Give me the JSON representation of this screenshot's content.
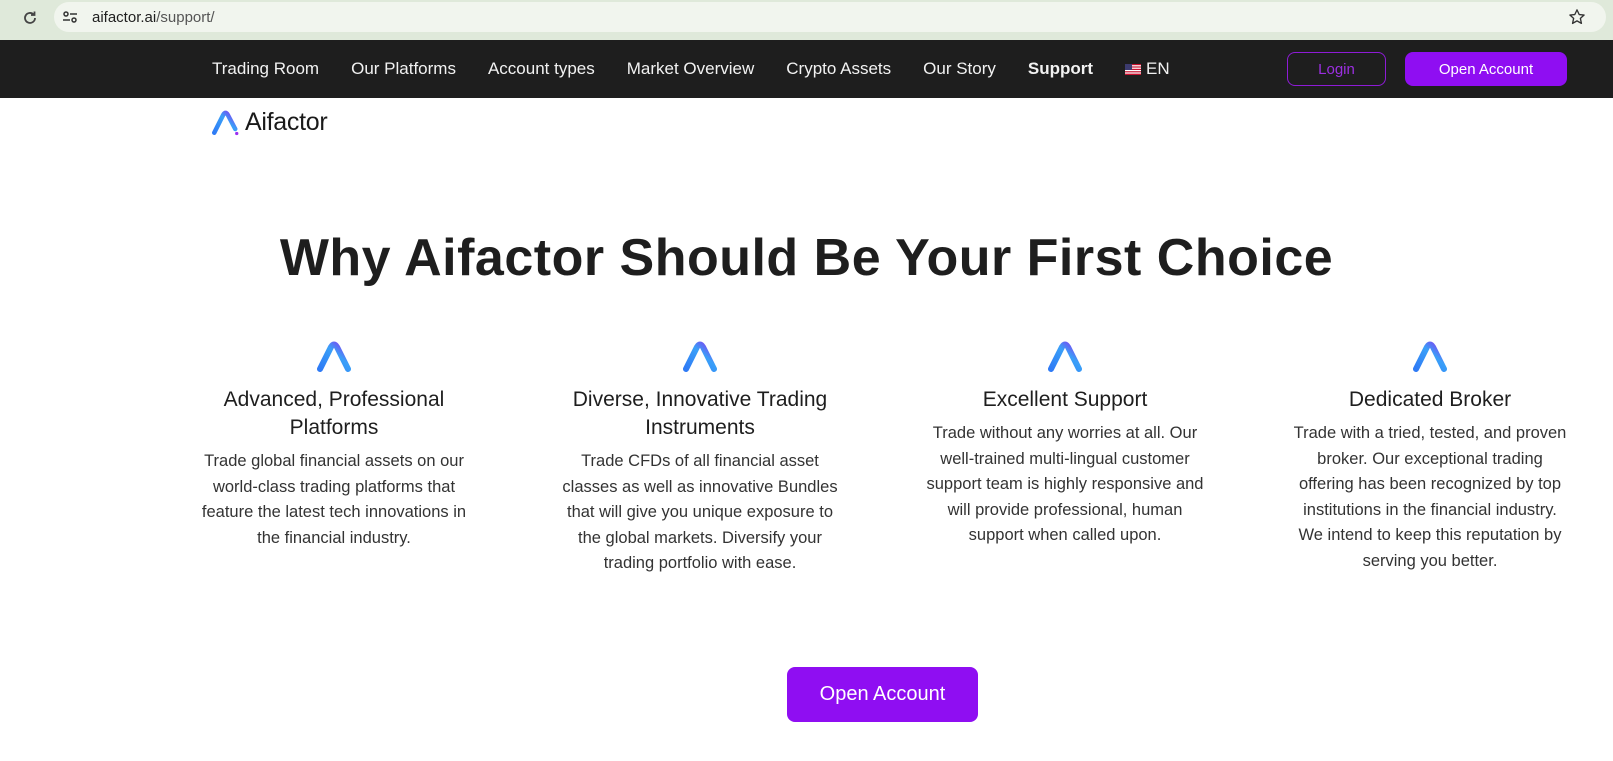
{
  "browser": {
    "url_domain": "aifactor.ai",
    "url_path": "/support/"
  },
  "nav": {
    "links": [
      {
        "label": "Trading Room"
      },
      {
        "label": "Our Platforms"
      },
      {
        "label": "Account types"
      },
      {
        "label": "Market Overview"
      },
      {
        "label": "Crypto Assets"
      },
      {
        "label": "Our Story"
      },
      {
        "label": "Support",
        "active": true
      }
    ],
    "language": "EN",
    "login_label": "Login",
    "open_account_label": "Open Account"
  },
  "logo": {
    "text": "Aifactor"
  },
  "main": {
    "heading": "Why Aifactor Should Be Your First Choice",
    "features": [
      {
        "title": "Advanced, Professional Platforms",
        "description": "Trade global financial assets on our world-class trading platforms that feature the latest tech innovations in the financial industry."
      },
      {
        "title": "Diverse, Innovative Trading Instruments",
        "description": "Trade CFDs of all financial asset classes as well as innovative Bundles that will give you unique exposure to the global markets. Diversify your trading portfolio with ease."
      },
      {
        "title": "Excellent Support",
        "description": "Trade without any worries at all. Our well-trained multi-lingual customer support team is highly responsive and will provide professional, human support when called upon."
      },
      {
        "title": "Dedicated Broker",
        "description": "Trade with a tried, tested, and proven broker. Our exceptional trading offering has been recognized by top institutions in the financial industry. We intend to keep this reputation by serving you better."
      }
    ],
    "cta_label": "Open Account"
  },
  "colors": {
    "brand_purple": "#8f0ef2",
    "nav_background": "#1e1e1e",
    "browser_bar": "#dfe9da"
  }
}
